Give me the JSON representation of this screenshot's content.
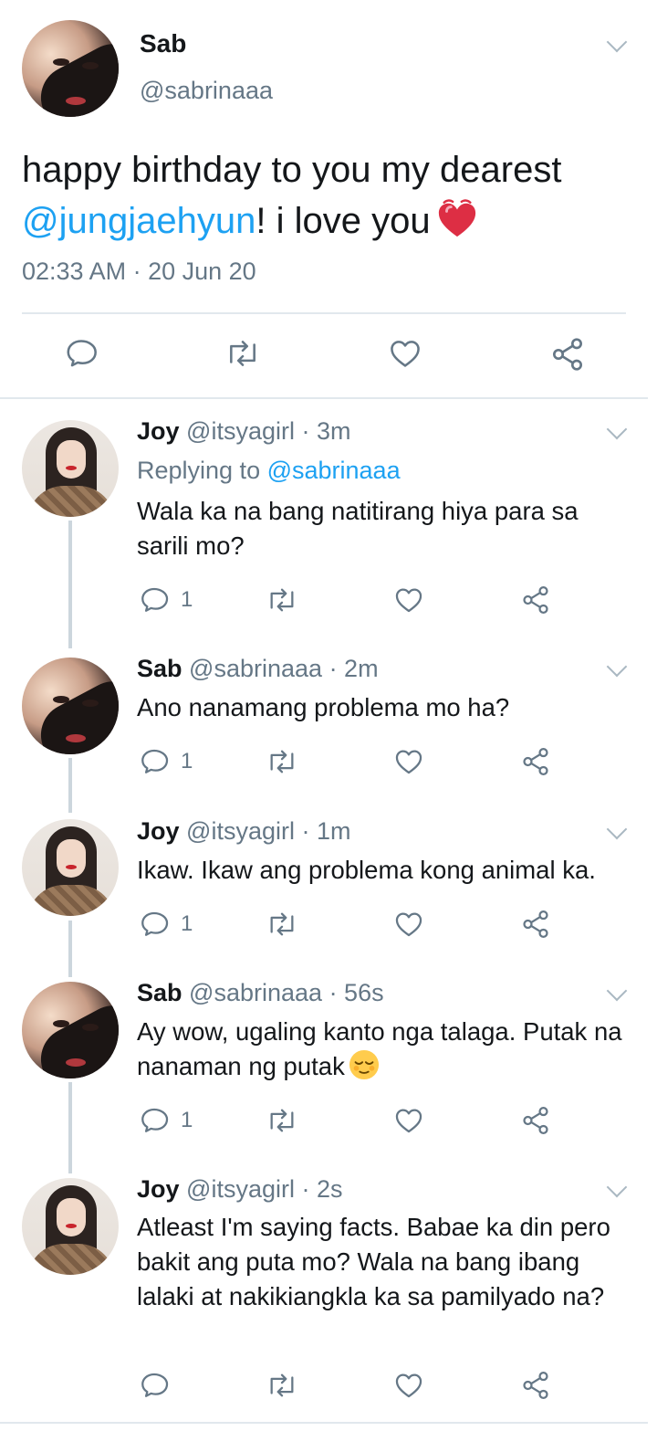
{
  "main_tweet": {
    "name": "Sab",
    "handle": "@sabrinaaa",
    "text_before": "happy birthday to you my dearest ",
    "mention": "@jungjaehyun",
    "text_after": "! i love you",
    "emoji": "revolving-heart",
    "timestamp": "02:33 AM · 20 Jun 20",
    "actions": [
      "reply-icon",
      "retweet-icon",
      "like-icon",
      "share-icon"
    ]
  },
  "replies": [
    {
      "name": "Joy",
      "handle": "@itsyagirl",
      "time": "· 3m",
      "replying_prefix": "Replying to ",
      "replying_to": "@sabrinaaa",
      "text": "Wala ka na bang natitirang hiya para sa sarili mo?",
      "reply_count": "1"
    },
    {
      "name": "Sab",
      "handle": "@sabrinaaa",
      "time": "· 2m",
      "text": "Ano nanamang problema mo ha?",
      "reply_count": "1"
    },
    {
      "name": "Joy",
      "handle": "@itsyagirl",
      "time": "· 1m",
      "text": "Ikaw. Ikaw ang problema kong animal ka.",
      "reply_count": "1"
    },
    {
      "name": "Sab",
      "handle": "@sabrinaaa",
      "time": "· 56s",
      "text": "Ay wow, ugaling kanto nga talaga. Putak na nanaman ng putak",
      "emoji": "relieved-face",
      "reply_count": "1"
    },
    {
      "name": "Joy",
      "handle": "@itsyagirl",
      "time": "· 2s",
      "text": "Atleast I'm saying facts. Babae ka din pero bakit ang puta mo? Wala na bang ibang lalaki at nakikiangkla ka sa pamilyado na?",
      "reply_count": ""
    }
  ],
  "colors": {
    "link": "#1da1f2",
    "secondary_text": "#657786",
    "icon_gray": "#657786",
    "divider": "#e1e8ed",
    "thread_line": "#ccd6dd"
  }
}
